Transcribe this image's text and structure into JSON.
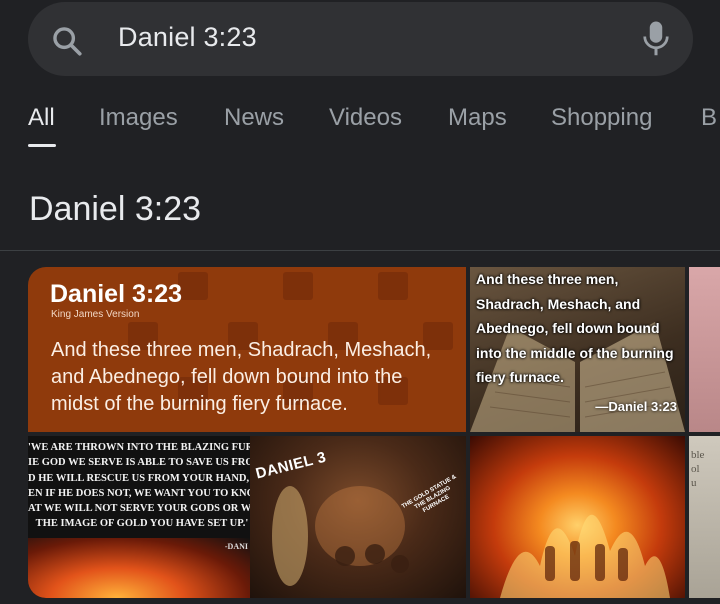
{
  "search": {
    "query": "Daniel 3:23"
  },
  "tabs": [
    {
      "label": "All",
      "active": true
    },
    {
      "label": "Images",
      "active": false
    },
    {
      "label": "News",
      "active": false
    },
    {
      "label": "Videos",
      "active": false
    },
    {
      "label": "Maps",
      "active": false
    },
    {
      "label": "Shopping",
      "active": false
    },
    {
      "label": "B",
      "active": false
    }
  ],
  "heading": "Daniel 3:23",
  "images": {
    "card1": {
      "title": "Daniel 3:23",
      "version": "King James Version",
      "verse": "And these three men, Shadrach, Meshach, and Abednego, fell down bound into the midst of the burning fiery furnace."
    },
    "card2": {
      "verse": "And these three men, Shadrach, Meshach, and Abednego, fell down bound into the middle of the burning fiery furnace.",
      "ref": "—Daniel 3:23"
    },
    "card4": {
      "quote": "'WE ARE THROWN INTO THE BLAZING FURNAC\nIE GOD WE SERVE IS ABLE TO SAVE US FROM I\nD HE WILL RESCUE US FROM YOUR HAND, O KI\nEN IF HE DOES NOT, WE WANT YOU TO KNOW, I\nAT WE WILL NOT SERVE YOUR GODS OR WORSI\n   THE IMAGE OF GOLD YOU HAVE SET UP.'",
      "sig": "-DANI"
    },
    "card5": {
      "label": "DANIEL 3",
      "sub": "THE GOLD STATUE & THE BLAZING FURNACE"
    },
    "card7": {
      "text": "ble\nol\nu"
    }
  },
  "colors": {
    "background": "#202124",
    "search_bar": "#303134",
    "text_primary": "#e8eaed",
    "text_secondary": "#9aa0a6",
    "card1_bg": "#8f3a0c"
  }
}
